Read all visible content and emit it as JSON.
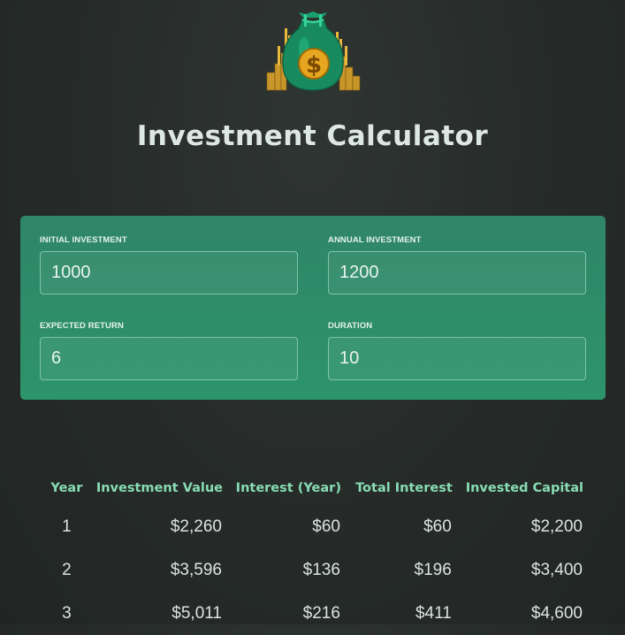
{
  "header": {
    "title": "Investment Calculator"
  },
  "inputs": [
    {
      "label": "INITIAL INVESTMENT",
      "value": "1000"
    },
    {
      "label": "ANNUAL INVESTMENT",
      "value": "1200"
    },
    {
      "label": "EXPECTED RETURN",
      "value": "6"
    },
    {
      "label": "DURATION",
      "value": "10"
    }
  ],
  "table": {
    "headers": [
      "Year",
      "Investment Value",
      "Interest (Year)",
      "Total Interest",
      "Invested Capital"
    ],
    "rows": [
      [
        "1",
        "$2,260",
        "$60",
        "$60",
        "$2,200"
      ],
      [
        "2",
        "$3,596",
        "$136",
        "$196",
        "$3,400"
      ],
      [
        "3",
        "$5,011",
        "$216",
        "$411",
        "$4,600"
      ]
    ]
  },
  "colors": {
    "background": "#262b29",
    "panel": "#2d946c",
    "accent": "#88dcb4"
  },
  "icons": {
    "logo": "money-bag-icon"
  }
}
